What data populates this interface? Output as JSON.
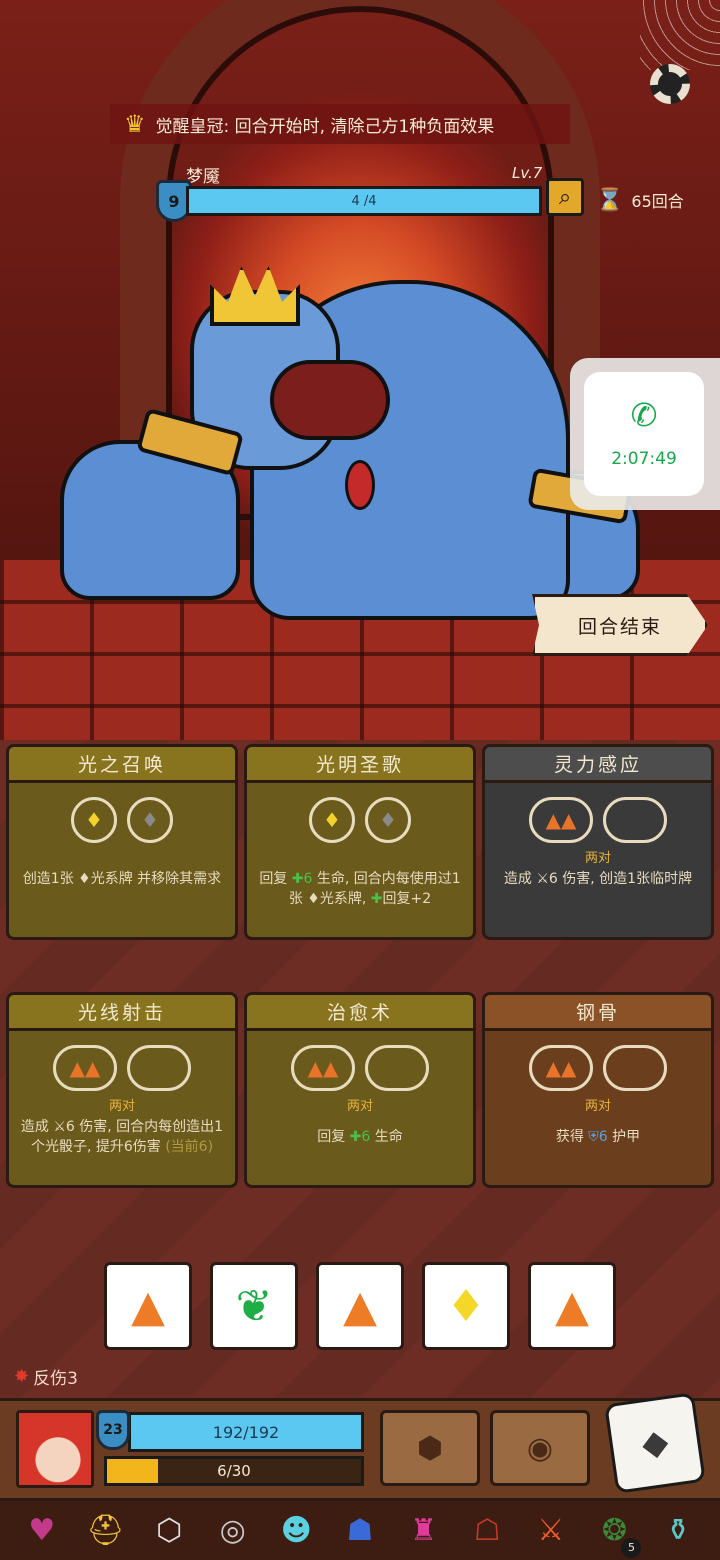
{
  "header": {
    "crown_text": "觉醒皇冠: 回合开始时, 清除己方1种负面效果",
    "boss_name": "梦魇",
    "boss_level": "Lv.7",
    "boss_shield": "9",
    "boss_hp": "4 /4",
    "round_count": "65回合"
  },
  "call": {
    "time": "2:07:49"
  },
  "end_turn_label": "回合结束",
  "cards": [
    {
      "title": "光之召唤",
      "sub": "",
      "desc": "创造1张 ♦光系牌 并移除其需求"
    },
    {
      "title": "光明圣歌",
      "sub": "",
      "desc_a": "回复 ",
      "desc_b": "✚6",
      "desc_c": " 生命, 回合内每使用过1张 ♦光系牌, ",
      "desc_d": "✚",
      "desc_e": "回复+2"
    },
    {
      "title": "灵力感应",
      "sub": "两对",
      "desc": "造成 ⚔6 伤害, 创造1张临时牌"
    },
    {
      "title": "光线射击",
      "sub": "两对",
      "desc_a": "造成 ⚔6 伤害, 回合内每创造出1个光骰子, 提升6伤害",
      "desc_b": " (当前6)"
    },
    {
      "title": "治愈术",
      "sub": "两对",
      "desc_a": "回复 ",
      "desc_b": "✚6",
      "desc_c": " 生命"
    },
    {
      "title": "钢骨",
      "sub": "两对",
      "desc_a": "获得 ",
      "desc_b": "⛨6",
      "desc_c": " 护甲"
    }
  ],
  "player": {
    "status": "反伤3",
    "level": "23",
    "hp": "192/192",
    "energy": "6/30",
    "energy_fraction": 0.2
  },
  "icons": {
    "crown": "crown-icon",
    "hourglass": "hourglass-icon",
    "search": "magnifier-icon",
    "phone": "phone-icon",
    "thorns": "thorns-icon",
    "settings": "gear-icon"
  }
}
